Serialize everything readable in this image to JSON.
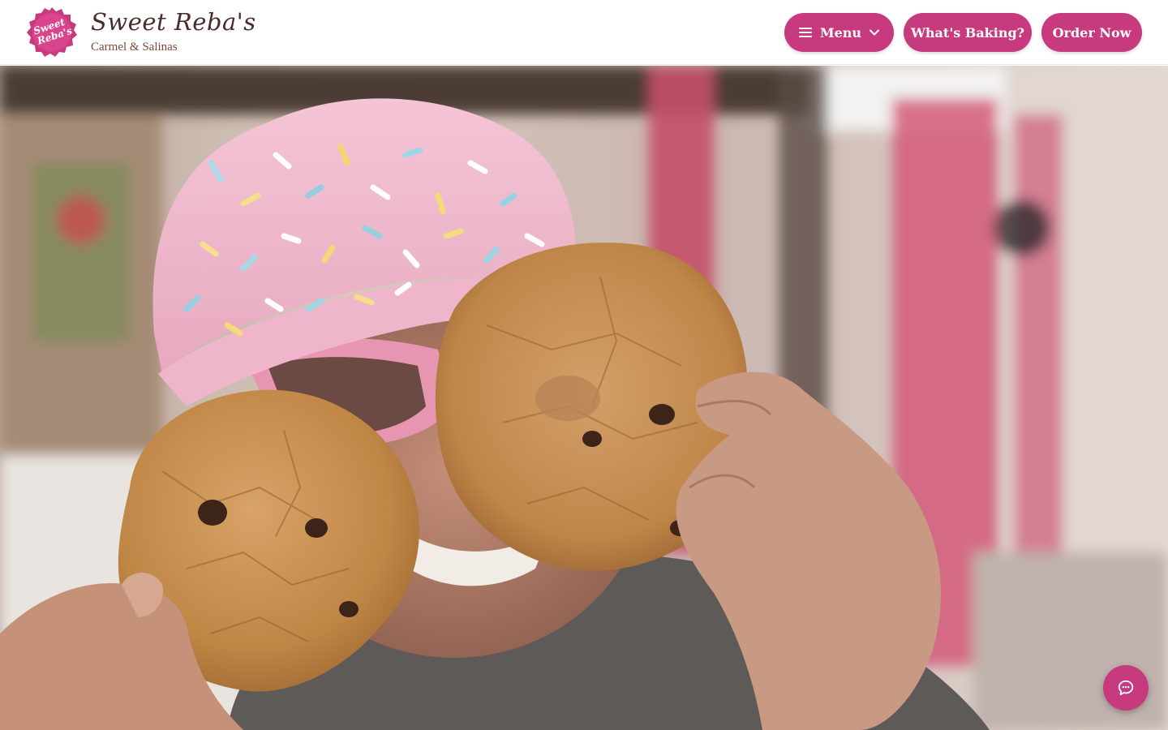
{
  "header": {
    "logo_text_line1": "Sweet",
    "logo_text_line2": "Reba's",
    "brand_name": "Sweet Reba's",
    "brand_subtitle": "Carmel & Salinas",
    "nav": {
      "menu_label": "Menu",
      "whats_baking_label": "What's Baking?",
      "order_now_label": "Order Now"
    }
  },
  "hero": {
    "image_alt": "Person in pink sprinkle cap holding two chocolate chip cookies"
  },
  "chat": {
    "icon": "chat-bubble-icon"
  },
  "colors": {
    "accent": "#c73a7e",
    "brand_text": "#4a2b2b",
    "subtitle_text": "#7a4a36"
  }
}
